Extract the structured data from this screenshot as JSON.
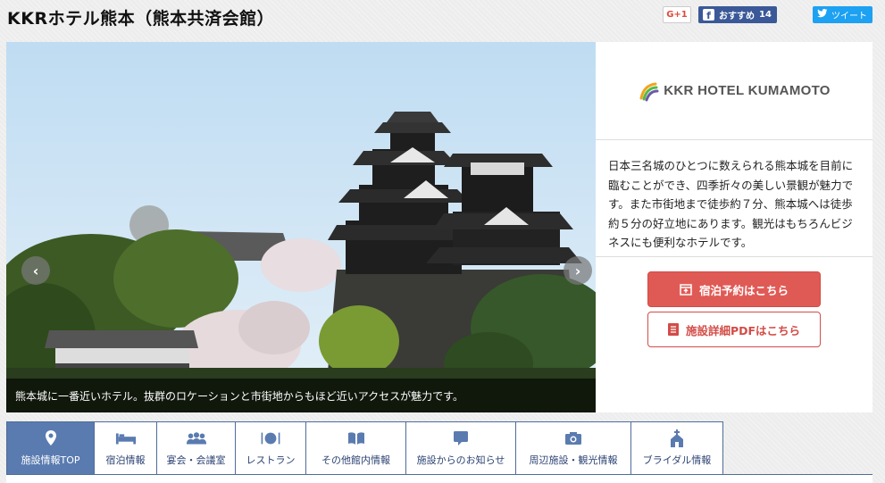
{
  "page": {
    "title": "KKRホテル熊本（熊本共済会館）"
  },
  "social": {
    "gplus_label": "G+1",
    "facebook_label": "おすすめ",
    "facebook_count": "14",
    "twitter_label": "ツイート"
  },
  "hero": {
    "caption": "熊本城に一番近いホテル。抜群のロケーションと市街地からもほど近いアクセスが魅力です。",
    "prev_icon": "chevron-left-icon",
    "next_icon": "chevron-right-icon"
  },
  "hotel_panel": {
    "logo_text": "KKR HOTEL KUMAMOTO",
    "description": "日本三名城のひとつに数えられる熊本城を目前に臨むことができ、四季折々の美しい景観が魅力です。また市街地まで徒歩約７分、熊本城へは徒歩約５分の好立地にあります。観光はもちろんビジネスにも便利なホテルです。",
    "reserve_button": "宿泊予約はこちら",
    "pdf_button": "施設詳細PDFはこちら"
  },
  "colors": {
    "accent_red": "#e05a55",
    "nav_blue": "#5a7bb0",
    "nav_text": "#2d4373"
  },
  "nav": {
    "tabs": [
      {
        "label": "施設情報TOP",
        "icon": "map-pin-icon",
        "active": true
      },
      {
        "label": "宿泊情報",
        "icon": "bed-icon",
        "active": false
      },
      {
        "label": "宴会・会議室",
        "icon": "group-icon",
        "active": false
      },
      {
        "label": "レストラン",
        "icon": "dining-icon",
        "active": false
      },
      {
        "label": "その他館内情報",
        "icon": "book-icon",
        "active": false
      },
      {
        "label": "施設からのお知らせ",
        "icon": "speech-bubble-icon",
        "active": false
      },
      {
        "label": "周辺施設・観光情報",
        "icon": "camera-icon",
        "active": false
      },
      {
        "label": "ブライダル情報",
        "icon": "chapel-icon",
        "active": false
      }
    ]
  }
}
